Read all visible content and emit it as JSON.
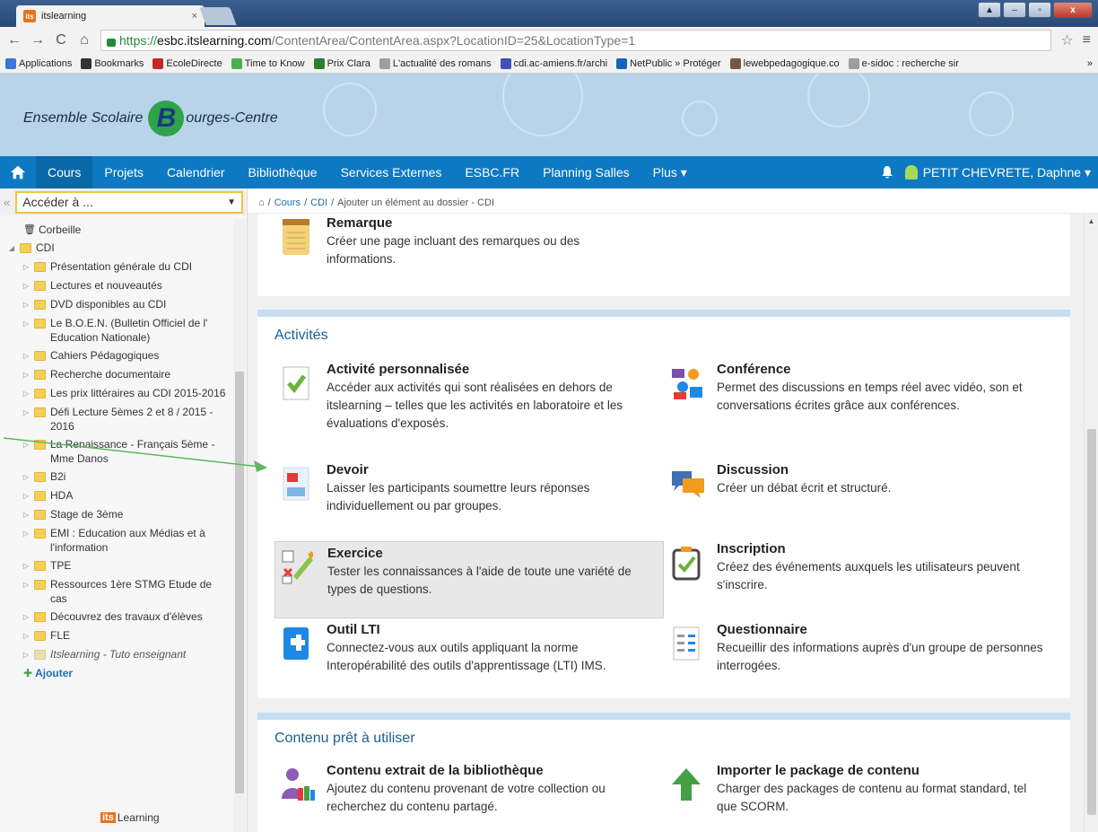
{
  "browser": {
    "tab_title": "itslearning",
    "tab_close": "×",
    "favicon_text": "its",
    "url_https": "https://",
    "url_host": "esbc.itslearning.com",
    "url_path": "/ContentArea/ContentArea.aspx?LocationID=25&LocationType=1",
    "back": "←",
    "forward": "→",
    "reload": "C",
    "home": "⌂",
    "star": "☆",
    "menu": "≡",
    "bookmarks": [
      {
        "label": "Applications",
        "color": "#3a78d6"
      },
      {
        "label": "Bookmarks",
        "color": "#333333"
      },
      {
        "label": "EcoleDirecte",
        "color": "#c62828"
      },
      {
        "label": "Time to Know",
        "color": "#4caf50"
      },
      {
        "label": "Prix Clara",
        "color": "#2e7d32"
      },
      {
        "label": "L'actualité des romans",
        "color": "#9e9e9e"
      },
      {
        "label": "cdi.ac-amiens.fr/archi",
        "color": "#3f51b5"
      },
      {
        "label": "NetPublic » Protéger",
        "color": "#1565c0"
      },
      {
        "label": "lewebpedagogique.co",
        "color": "#795548"
      },
      {
        "label": "e-sidoc : recherche sir",
        "color": "#9e9e9e"
      }
    ],
    "bookmarks_more": "»"
  },
  "header": {
    "logo_text_1": "Ensemble Scolaire",
    "logo_b": "B",
    "logo_text_2": "ourges-Centre"
  },
  "nav": {
    "items": [
      "Cours",
      "Projets",
      "Calendrier",
      "Bibliothèque",
      "Services Externes",
      "ESBC.FR",
      "Planning Salles",
      "Plus ▾"
    ],
    "active": "Cours",
    "user": "PETIT CHEVRETE, Daphne ▾"
  },
  "sidebar": {
    "search_placeholder": "Accéder à ...",
    "collapse": "«",
    "tree": [
      {
        "label": "Corbeille",
        "kind": "trash",
        "arrow": ""
      },
      {
        "label": "CDI",
        "kind": "folder",
        "arrow": "◢"
      },
      {
        "label": "Présentation générale du CDI",
        "kind": "folder",
        "arrow": "▷"
      },
      {
        "label": "Lectures et nouveautés",
        "kind": "folder",
        "arrow": "▷"
      },
      {
        "label": "DVD disponibles au CDI",
        "kind": "folder",
        "arrow": "▷"
      },
      {
        "label": "Le B.O.E.N. (Bulletin Officiel de l' Education Nationale)",
        "kind": "folder",
        "arrow": "▷"
      },
      {
        "label": "Cahiers Pédagogiques",
        "kind": "folder",
        "arrow": "▷"
      },
      {
        "label": "Recherche documentaire",
        "kind": "folder",
        "arrow": "▷"
      },
      {
        "label": "Les prix littéraires au CDI 2015-2016",
        "kind": "folder",
        "arrow": "▷"
      },
      {
        "label": "Défi Lecture 5èmes 2 et 8 / 2015 - 2016",
        "kind": "folder",
        "arrow": "▷"
      },
      {
        "label": "La Renaissance - Français 5ème - Mme Danos",
        "kind": "folder",
        "arrow": "▷"
      },
      {
        "label": "B2i",
        "kind": "folder",
        "arrow": "▷"
      },
      {
        "label": "HDA",
        "kind": "folder",
        "arrow": "▷"
      },
      {
        "label": "Stage de 3ème",
        "kind": "folder",
        "arrow": "▷"
      },
      {
        "label": "EMI : Education aux Médias et à l'information",
        "kind": "folder",
        "arrow": "▷"
      },
      {
        "label": "TPE",
        "kind": "folder",
        "arrow": "▷"
      },
      {
        "label": "Ressources 1ère STMG Etude de cas",
        "kind": "folder",
        "arrow": "▷"
      },
      {
        "label": "Découvrez des travaux d'élèves",
        "kind": "folder",
        "arrow": "▷"
      },
      {
        "label": "FLE",
        "kind": "folder",
        "arrow": "▷"
      },
      {
        "label": "Itslearning - Tuto enseignant",
        "kind": "folder-grey",
        "arrow": "▷"
      },
      {
        "label": "Ajouter",
        "kind": "add",
        "arrow": ""
      }
    ],
    "footer_its": "its",
    "footer_learning": "Learning"
  },
  "breadcrumb": {
    "sep": "/",
    "items": [
      "Cours",
      "CDI"
    ],
    "current": "Ajouter un élément au dossier - CDI"
  },
  "top_item": {
    "title": "Remarque",
    "desc": "Créer une page incluant des remarques ou des informations."
  },
  "activities": {
    "heading": "Activités",
    "items": [
      {
        "title": "Activité personnalisée",
        "desc": "Accéder aux activités qui sont réalisées en dehors de itslearning – telles que les activités en laboratoire et les évaluations d'exposés."
      },
      {
        "title": "Conférence",
        "desc": "Permet des discussions en temps réel avec vidéo, son et conversations écrites grâce aux conférences."
      },
      {
        "title": "Devoir",
        "desc": "Laisser les participants soumettre leurs réponses individuellement ou par groupes."
      },
      {
        "title": "Discussion",
        "desc": "Créer un débat écrit et structuré."
      },
      {
        "title": "Exercice",
        "desc": "Tester les connaissances à l'aide de toute une variété de types de questions."
      },
      {
        "title": "Inscription",
        "desc": "Créez des événements auxquels les utilisateurs peuvent s'inscrire."
      },
      {
        "title": "Outil LTI",
        "desc": "Connectez-vous aux outils appliquant la norme Interopérabilité des outils d'apprentissage (LTI) IMS."
      },
      {
        "title": "Questionnaire",
        "desc": "Recueillir des informations auprès d'un groupe de personnes interrogées."
      }
    ]
  },
  "ready_content": {
    "heading": "Contenu prêt à utiliser",
    "items": [
      {
        "title": "Contenu extrait de la bibliothèque",
        "desc": "Ajoutez du contenu provenant de votre collection ou recherchez du contenu partagé."
      },
      {
        "title": "Importer le package de contenu",
        "desc": "Charger des packages de contenu au format standard, tel que SCORM."
      }
    ]
  },
  "colors": {
    "nav_blue": "#0c79c2",
    "header_blue": "#b8d4ea",
    "annotation_arrow": "#5cb85c"
  }
}
